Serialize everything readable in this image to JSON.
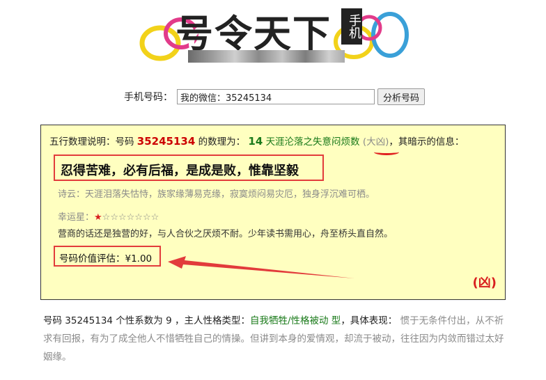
{
  "logo": {
    "title": "号令天下",
    "badge": "手机"
  },
  "search": {
    "label": "手机号码：",
    "input_value": "我的微信：35245134",
    "button": "分析号码"
  },
  "result": {
    "intro_prefix": "五行数理说明：号码",
    "number": "35245134",
    "intro_mid": "的数理为：",
    "score": "14",
    "phrase": "天涯沦落之失意闷烦数",
    "fortune": "(大凶)",
    "intro_suffix": "，其暗示的信息：",
    "motto": "忍得苦难，必有后福，是成是败，惟靠坚毅",
    "poem": "诗云：天涯泪落失怙恃，族家缘薄易克缘，寂寞烦闷易灾厄，独身浮沉难可栖。",
    "luck_label": "幸运星：",
    "stars_on": "★",
    "stars_off": "☆☆☆☆☆☆☆",
    "stars_rating": 1,
    "stars_total": 8,
    "description": "营商的话还是独营的好，与人合伙之厌烦不耐。少年读书需用心，舟至桥头直自然。",
    "value_label": "号码价值评估：",
    "value_amount": "¥1.00",
    "verdict": "(凶)"
  },
  "personality": {
    "prefix": "号码 35245134 个性系数为 9 ，主人性格类型：",
    "type": "自我牺牲/性格被动 型",
    "mid": "，具体表现：",
    "desc_grey": "惯于无条件付出，从不",
    "desc_rest": "祈求有回报，有为了成全他人不惜牺牲自己的情操。但讲到本身的爱情观，却流于被动，往往因为内敛而错过太好姻缘。"
  },
  "colors": {
    "box_bg": "#ffffc0",
    "highlight_red": "#e23b3b",
    "number_red": "#cc0000",
    "score_green": "#1a7a1a"
  }
}
